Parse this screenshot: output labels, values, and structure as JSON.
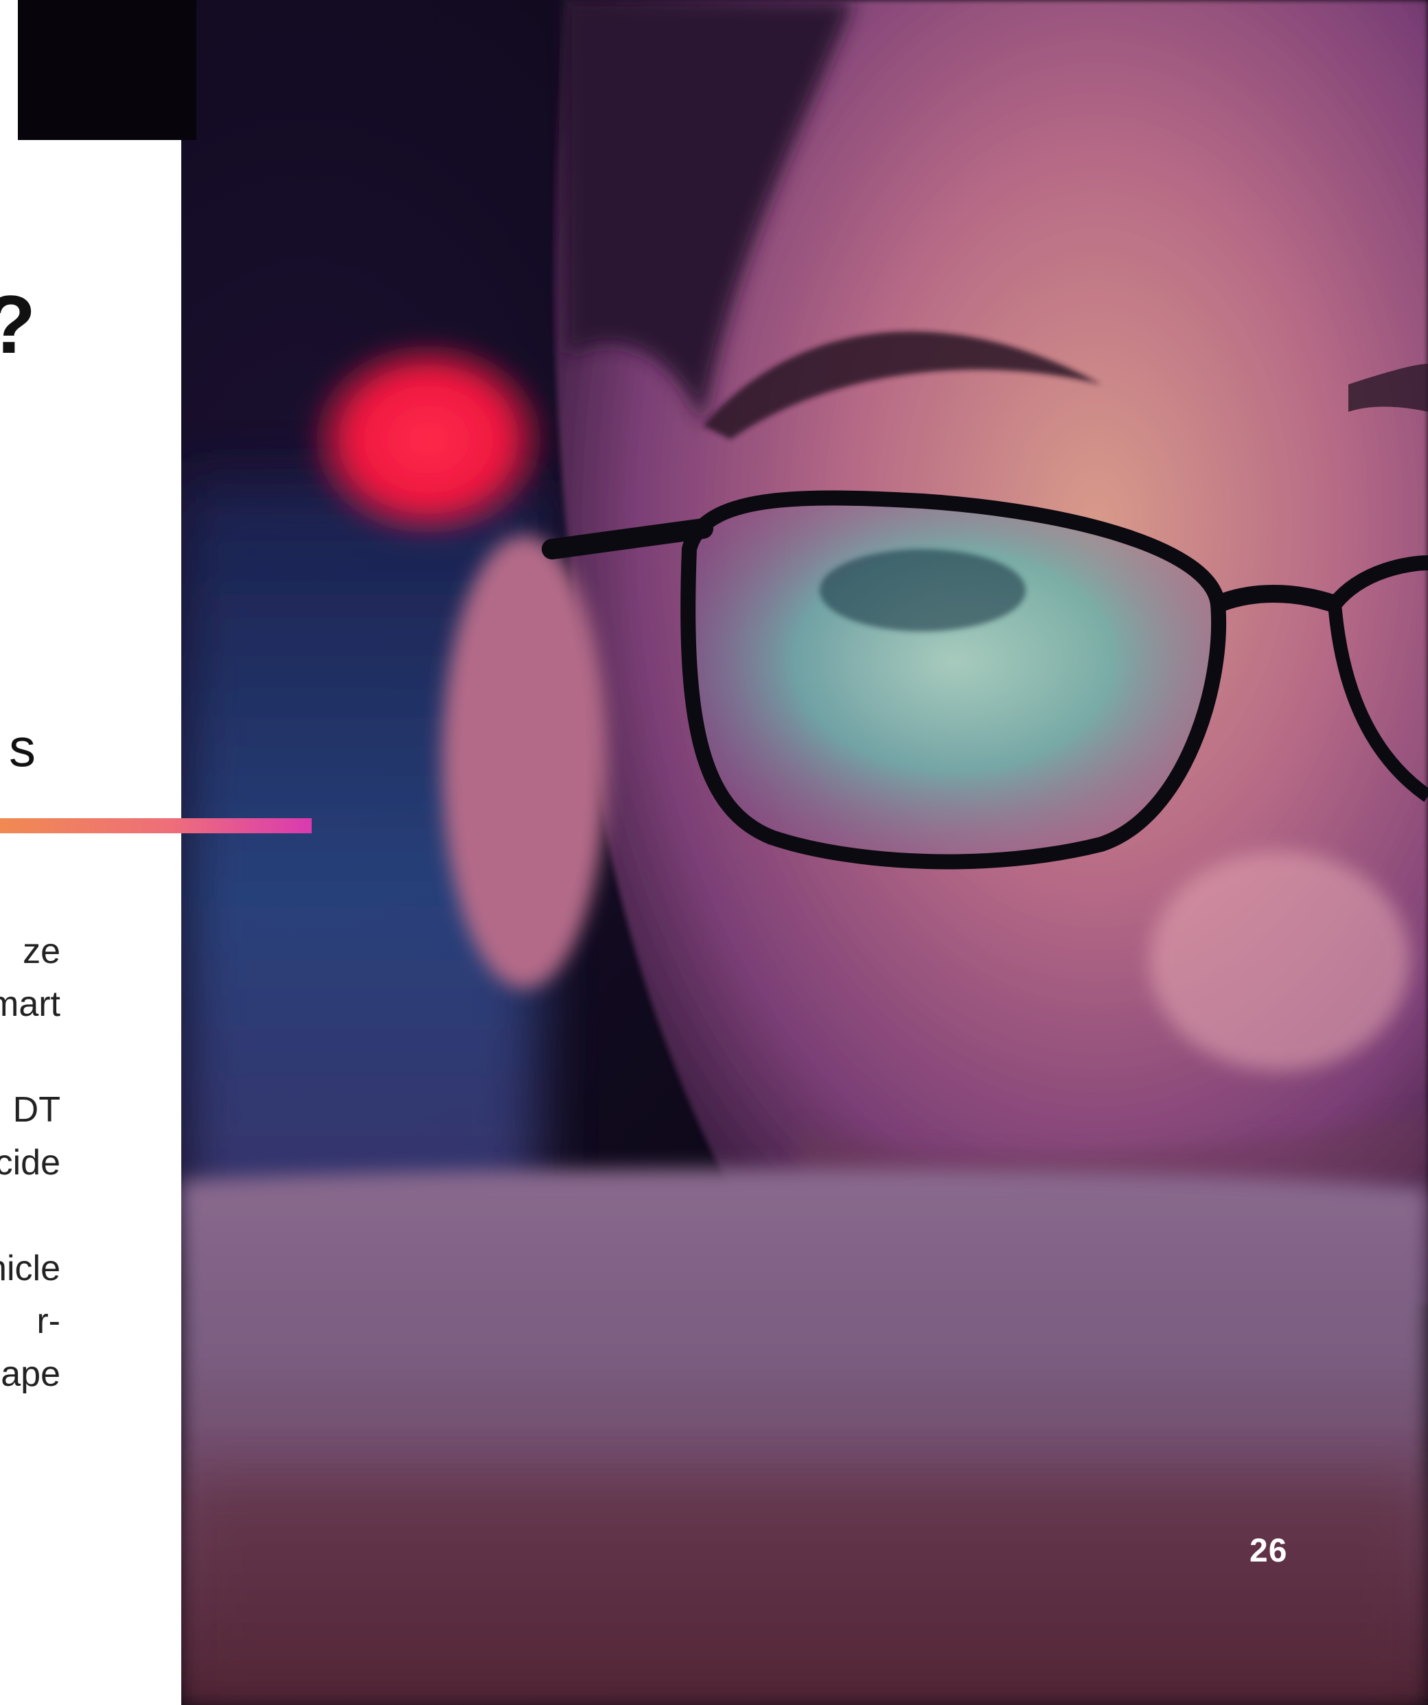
{
  "heading": {
    "fragment_1": "?",
    "fragment_2": "s"
  },
  "body": {
    "lines": [
      "ze",
      "mart",
      "",
      "DT",
      "cide",
      "",
      "hicle",
      "r-",
      "ape"
    ]
  },
  "footer": {
    "page_number": "26"
  },
  "colors": {
    "accent_start": "#f08a52",
    "accent_mid": "#ee6e7a",
    "accent_end": "#d93ab0",
    "band": "#07040c"
  },
  "photo": {
    "subject": "face-with-glasses-photo"
  }
}
